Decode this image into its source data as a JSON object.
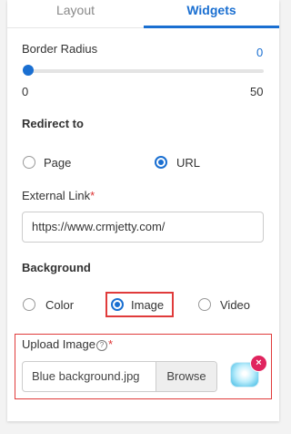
{
  "tabs": {
    "layout": "Layout",
    "widgets": "Widgets",
    "active": "Widgets"
  },
  "border_radius": {
    "label": "Border Radius",
    "value": "0",
    "min": "0",
    "max": "50"
  },
  "redirect": {
    "label": "Redirect to",
    "options": [
      "Page",
      "URL"
    ],
    "selected": "URL"
  },
  "external_link": {
    "label": "External Link",
    "required_mark": "*",
    "value": "https://www.crmjetty.com/"
  },
  "background": {
    "label": "Background",
    "options": [
      "Color",
      "Image",
      "Video"
    ],
    "selected": "Image"
  },
  "upload": {
    "label": "Upload Image",
    "help": "?",
    "required_mark": "*",
    "file_name": "Blue background.jpg",
    "browse_label": "Browse",
    "remove_label": "×"
  },
  "colors": {
    "accent": "#1a6fd1",
    "highlight": "#e03b3b",
    "remove": "#e0245e"
  }
}
